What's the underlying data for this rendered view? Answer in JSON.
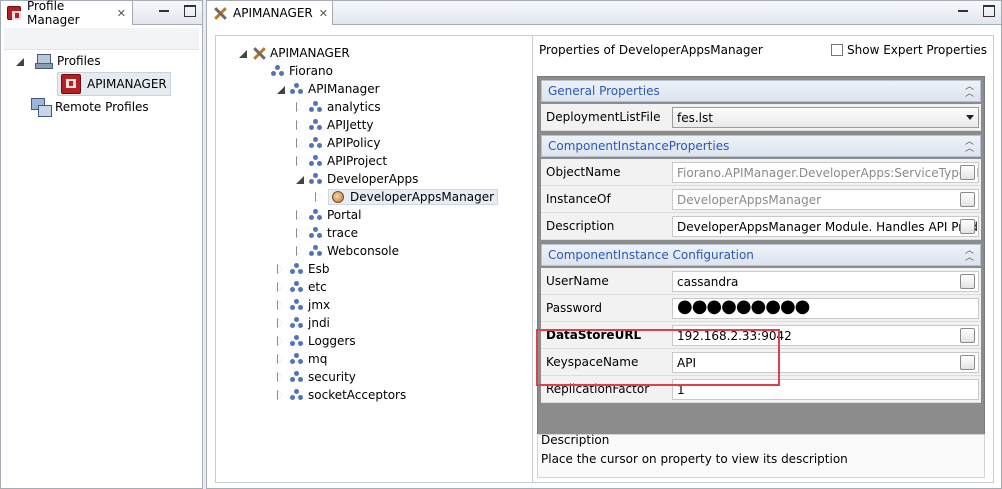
{
  "profile_manager": {
    "tab_title": "Profile Manager",
    "tree": {
      "profiles_label": "Profiles",
      "apimanager_label": "APIMANAGER",
      "remote_label": "Remote Profiles"
    }
  },
  "api_view": {
    "tab_title": "APIMANAGER",
    "tree": [
      {
        "label": "APIMANAGER",
        "icon": "tools-icon",
        "twisty": "open"
      },
      {
        "label": "Fiorano",
        "icon": "node-icon",
        "twisty": "none"
      },
      {
        "label": "APIManager",
        "icon": "node-icon",
        "twisty": "open"
      },
      {
        "label": "analytics",
        "icon": "node-icon",
        "twisty": "closed"
      },
      {
        "label": "APIJetty",
        "icon": "node-icon",
        "twisty": "closed"
      },
      {
        "label": "APIPolicy",
        "icon": "node-icon",
        "twisty": "closed"
      },
      {
        "label": "APIProject",
        "icon": "node-icon",
        "twisty": "closed"
      },
      {
        "label": "DeveloperApps",
        "icon": "node-icon",
        "twisty": "open"
      },
      {
        "label": "DeveloperAppsManager",
        "icon": "component-icon",
        "twisty": "closed"
      },
      {
        "label": "Portal",
        "icon": "node-icon",
        "twisty": "closed"
      },
      {
        "label": "trace",
        "icon": "node-icon",
        "twisty": "closed"
      },
      {
        "label": "Webconsole",
        "icon": "node-icon",
        "twisty": "closed"
      },
      {
        "label": "Esb",
        "icon": "node-icon",
        "twisty": "closed"
      },
      {
        "label": "etc",
        "icon": "node-icon",
        "twisty": "closed"
      },
      {
        "label": "jmx",
        "icon": "node-icon",
        "twisty": "closed"
      },
      {
        "label": "jndi",
        "icon": "node-icon",
        "twisty": "closed"
      },
      {
        "label": "Loggers",
        "icon": "node-icon",
        "twisty": "closed"
      },
      {
        "label": "mq",
        "icon": "node-icon",
        "twisty": "closed"
      },
      {
        "label": "security",
        "icon": "node-icon",
        "twisty": "closed"
      },
      {
        "label": "socketAcceptors",
        "icon": "node-icon",
        "twisty": "closed"
      }
    ],
    "props": {
      "title": "Properties of DeveloperAppsManager",
      "show_expert_label": "Show Expert Properties",
      "sections": [
        {
          "title": "General Properties",
          "rows": [
            {
              "label": "DeploymentListFile",
              "value": "fes.lst",
              "kind": "combo"
            }
          ]
        },
        {
          "title": "ComponentInstanceProperties",
          "rows": [
            {
              "label": "ObjectName",
              "value": "Fiorano.APIManager.DeveloperApps:ServiceType=De",
              "kind": "readonly-ellipsis"
            },
            {
              "label": "InstanceOf",
              "value": "DeveloperAppsManager",
              "kind": "readonly-ellipsis"
            },
            {
              "label": "Description",
              "value": "DeveloperAppsManager Module. Handles API Produ",
              "kind": "ellipsis"
            }
          ]
        },
        {
          "title": "ComponentInstance Configuration",
          "rows": [
            {
              "label": "UserName",
              "value": "cassandra",
              "kind": "ellipsis"
            },
            {
              "label": "Password",
              "value": "●●●●●●●●●",
              "kind": "password"
            },
            {
              "label": "DataStoreURL",
              "value": "192.168.2.33:9042",
              "kind": "ellipsis",
              "bold": true
            },
            {
              "label": "KeyspaceName",
              "value": "API",
              "kind": "ellipsis"
            },
            {
              "label": "ReplicationFactor",
              "value": "1",
              "kind": "text"
            }
          ]
        }
      ],
      "description_title": "Description",
      "description_text": "Place the cursor on property to view its description"
    }
  },
  "colors": {
    "section_title": "#2b58b5",
    "highlight": "#d9434b"
  }
}
